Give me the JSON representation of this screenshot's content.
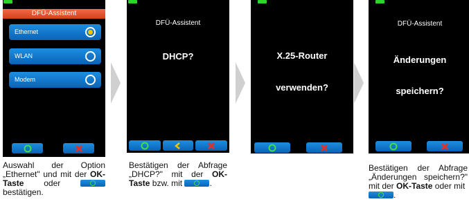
{
  "screens": [
    {
      "header": "DFÜ-Assistent",
      "options": [
        {
          "label": "Ethernet",
          "selected": true
        },
        {
          "label": "WLAN",
          "selected": false
        },
        {
          "label": "Modem",
          "selected": false
        }
      ]
    },
    {
      "title": "DFÜ-Assistent",
      "question": "DHCP?"
    },
    {
      "line1": "X.25-Router",
      "line2": "verwenden?"
    },
    {
      "title": "DFÜ-Assistent",
      "line1": "Änderungen",
      "line2": "speichern?"
    }
  ],
  "captions": {
    "c1_a": "Auswahl der Option „Ethernet\" und mit der ",
    "c1_bold": "OK-Taste",
    "c1_b": " oder",
    "c1_c": " bestätigen.",
    "c2_a": "Bestätigen der Abfrage „DHCP?\" mit der ",
    "c2_bold": "OK-Taste",
    "c2_b": " bzw. mit ",
    "c2_c": ".",
    "c4_a": "Bestätigen der Abfrage „Änderungen speichern?\" mit der ",
    "c4_bold": "OK-Taste",
    "c4_b": " oder mit",
    "c4_c": "."
  },
  "colors": {
    "led_active": "#2bd62b",
    "button_blue": "#0a63b7",
    "header_orange": "#e05530",
    "radio_selected": "#f5c400",
    "cancel_red": "#e0312b",
    "back_yellow": "#f5c400"
  }
}
